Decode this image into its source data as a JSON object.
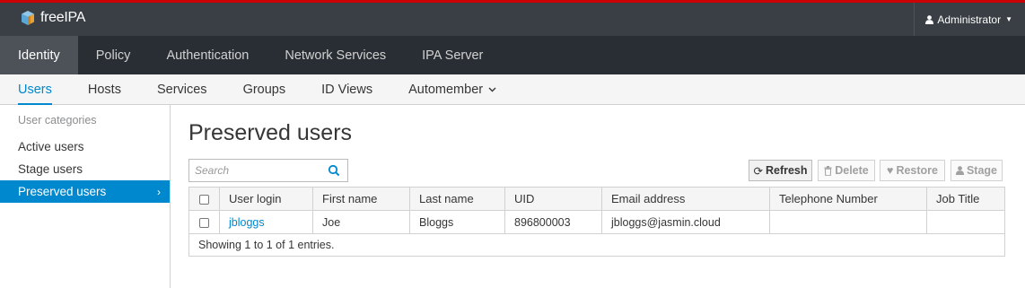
{
  "brand": {
    "name": "freeIPA"
  },
  "user_menu": {
    "label": "Administrator"
  },
  "main_nav": [
    {
      "label": "Identity",
      "active": true
    },
    {
      "label": "Policy",
      "active": false
    },
    {
      "label": "Authentication",
      "active": false
    },
    {
      "label": "Network Services",
      "active": false
    },
    {
      "label": "IPA Server",
      "active": false
    }
  ],
  "sub_nav": [
    {
      "label": "Users",
      "active": true
    },
    {
      "label": "Hosts",
      "active": false
    },
    {
      "label": "Services",
      "active": false
    },
    {
      "label": "Groups",
      "active": false
    },
    {
      "label": "ID Views",
      "active": false
    },
    {
      "label": "Automember",
      "active": false,
      "has_dropdown": true
    }
  ],
  "sidebar": {
    "category_label": "User categories",
    "items": [
      {
        "label": "Active users",
        "active": false
      },
      {
        "label": "Stage users",
        "active": false
      },
      {
        "label": "Preserved users",
        "active": true
      }
    ]
  },
  "page": {
    "title": "Preserved users",
    "search": {
      "placeholder": "Search",
      "value": ""
    },
    "actions": [
      {
        "label": "Refresh",
        "icon": "refresh-icon",
        "enabled": true
      },
      {
        "label": "Delete",
        "icon": "trash-icon",
        "enabled": false
      },
      {
        "label": "Restore",
        "icon": "heart-icon",
        "enabled": false
      },
      {
        "label": "Stage",
        "icon": "user-icon",
        "enabled": false
      }
    ]
  },
  "table": {
    "columns": [
      "User login",
      "First name",
      "Last name",
      "UID",
      "Email address",
      "Telephone Number",
      "Job Title"
    ],
    "rows": [
      {
        "login": "jbloggs",
        "first_name": "Joe",
        "last_name": "Bloggs",
        "uid": "896800003",
        "email": "jbloggs@jasmin.cloud",
        "phone": "",
        "job_title": ""
      }
    ],
    "footer": "Showing 1 to 1 of 1 entries."
  },
  "colors": {
    "accent": "#0088ce",
    "topbar": "#393f44",
    "mainnav": "#292e34",
    "top_stripe": "#cc0000"
  }
}
